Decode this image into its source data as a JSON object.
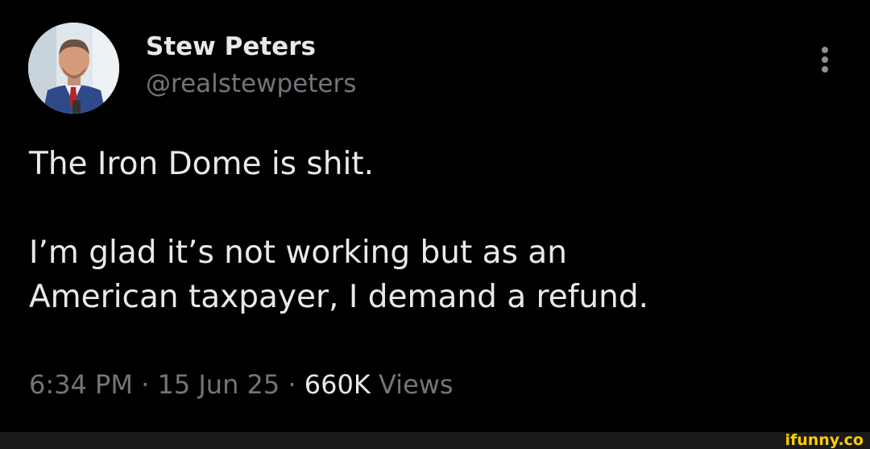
{
  "author": {
    "name": "Stew Peters",
    "handle": "@realstewpeters",
    "avatar_icon": "profile-photo"
  },
  "menu": {
    "icon": "more-vertical-icon"
  },
  "tweet": {
    "line1": "The Iron Dome is shit.",
    "line2": "I’m glad it’s not working but as an",
    "line3": "American taxpayer, I demand a refund."
  },
  "meta": {
    "time": "6:34 PM",
    "separator": " · ",
    "date": "15 Jun 25",
    "views_count": "660K",
    "views_label": " Views"
  },
  "watermark": {
    "text": "ifunny.co",
    "color": "#ffcc00"
  },
  "colors": {
    "background": "#000000",
    "primary_text": "#e7e9ea",
    "secondary_text": "#71767b"
  }
}
